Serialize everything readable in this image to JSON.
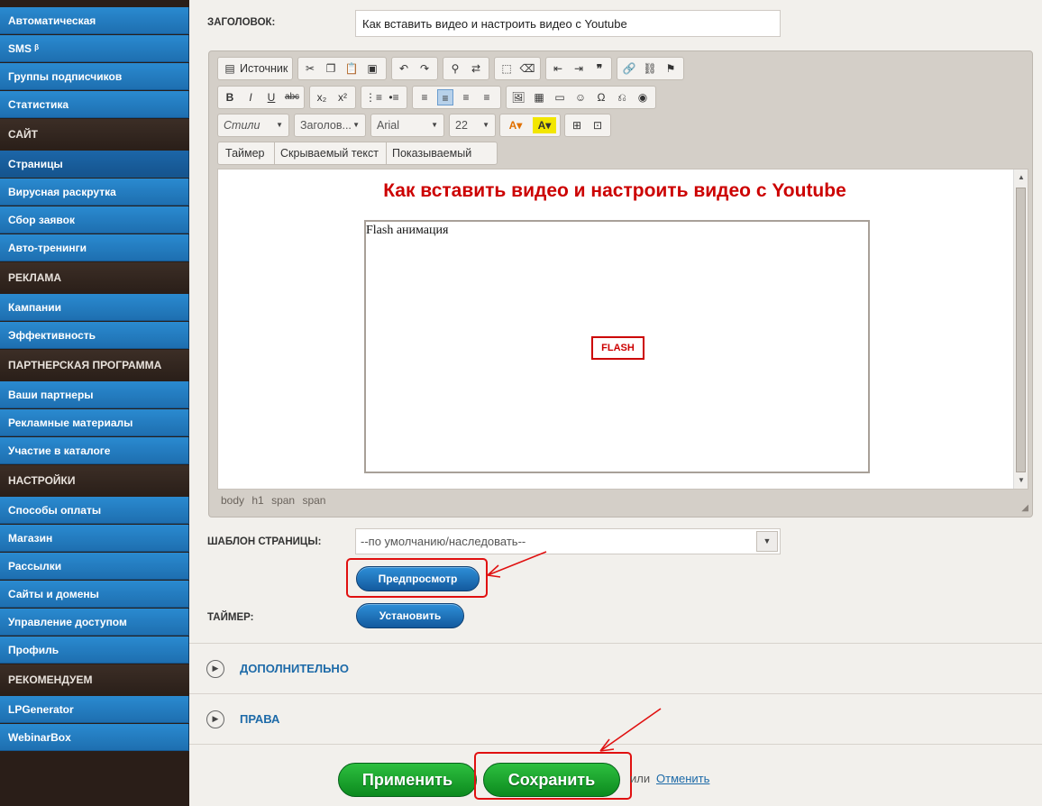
{
  "sidebar": {
    "items": [
      {
        "label": "Автоматическая",
        "type": "item"
      },
      {
        "label": "SMS ᵝ",
        "type": "item"
      },
      {
        "label": "Группы подписчиков",
        "type": "item"
      },
      {
        "label": "Статистика",
        "type": "item"
      },
      {
        "label": "САЙТ",
        "type": "header"
      },
      {
        "label": "Страницы",
        "type": "item",
        "active": true
      },
      {
        "label": "Вирусная раскрутка",
        "type": "item"
      },
      {
        "label": "Сбор заявок",
        "type": "item"
      },
      {
        "label": "Авто-тренинги",
        "type": "item"
      },
      {
        "label": "РЕКЛАМА",
        "type": "header"
      },
      {
        "label": "Кампании",
        "type": "item"
      },
      {
        "label": "Эффективность",
        "type": "item"
      },
      {
        "label": "ПАРТНЕРСКАЯ ПРОГРАММА",
        "type": "header"
      },
      {
        "label": "Ваши партнеры",
        "type": "item"
      },
      {
        "label": "Рекламные материалы",
        "type": "item"
      },
      {
        "label": "Участие в каталоге",
        "type": "item"
      },
      {
        "label": "НАСТРОЙКИ",
        "type": "header"
      },
      {
        "label": "Способы оплаты",
        "type": "item"
      },
      {
        "label": "Магазин",
        "type": "item"
      },
      {
        "label": "Рассылки",
        "type": "item"
      },
      {
        "label": "Сайты и домены",
        "type": "item"
      },
      {
        "label": "Управление доступом",
        "type": "item"
      },
      {
        "label": "Профиль",
        "type": "item"
      },
      {
        "label": "РЕКОМЕНДУЕМ",
        "type": "header"
      },
      {
        "label": "LPGenerator",
        "type": "item"
      },
      {
        "label": "WebinarBox",
        "type": "item"
      }
    ]
  },
  "form": {
    "title_label": "ЗАГОЛОВОК:",
    "title_value": "Как вставить видео и настроить видео с Youtube",
    "template_label": "ШАБЛОН СТРАНИЦЫ:",
    "template_value": "--по умолчанию/наследовать--",
    "preview_button": "Предпросмотр",
    "timer_label": "ТАЙМЕР:",
    "timer_button": "Установить"
  },
  "editor": {
    "source_button": "Источник",
    "styles_combo": "Стили",
    "format_combo": "Заголов...",
    "font_combo": "Arial",
    "size_combo": "22",
    "custom_buttons": [
      "Таймер",
      "Скрываемый текст",
      "Показываемый текст"
    ],
    "content_heading": "Как вставить видео и настроить видео с Youtube",
    "flash_label": "Flash анимация",
    "flash_badge": "FLASH",
    "path": [
      "body",
      "h1",
      "span",
      "span"
    ]
  },
  "sections": [
    {
      "title": "ДОПОЛНИТЕЛЬНО"
    },
    {
      "title": "ПРАВА"
    }
  ],
  "actions": {
    "apply_button": "Применить",
    "save_button": "Сохранить",
    "or_text": "или",
    "cancel_link": "Отменить"
  },
  "colors": {
    "sidebar_item": "#1e6fb0",
    "sidebar_header": "#2a1f19",
    "heading_red": "#cc0000",
    "annotation_red": "#e01010",
    "button_blue": "#145a9e",
    "button_green": "#0c8a1e"
  }
}
